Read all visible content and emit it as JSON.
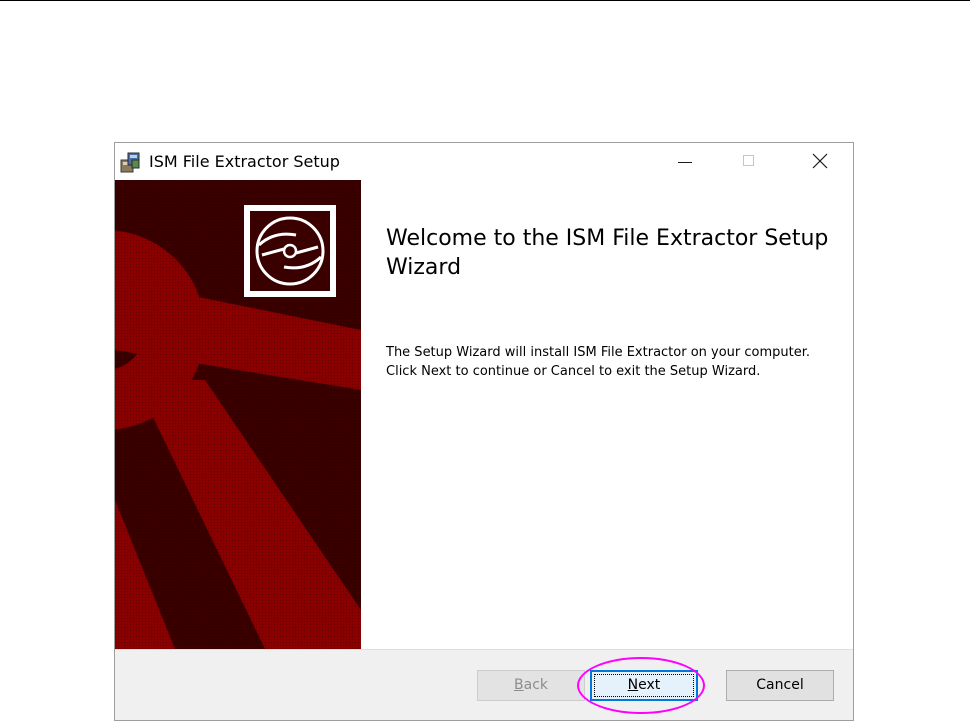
{
  "window": {
    "title": "ISM File Extractor Setup",
    "icon": "installer-package-icon",
    "controls": {
      "minimize_icon": "minimize-icon",
      "maximize_icon": "maximize-icon",
      "close_icon": "close-icon"
    }
  },
  "welcome": {
    "heading": "Welcome to the ISM File Extractor Setup Wizard",
    "body": "The Setup Wizard will install ISM File Extractor on your computer. Click Next to continue or Cancel to exit the Setup Wizard."
  },
  "banner": {
    "icon": "cd-disc-icon"
  },
  "buttons": {
    "back": {
      "prefix": "",
      "mnemonic": "B",
      "rest": "ack",
      "enabled": false
    },
    "next": {
      "prefix": "",
      "mnemonic": "N",
      "rest": "ext",
      "enabled": true,
      "focused": true
    },
    "cancel": {
      "label": "Cancel",
      "enabled": true
    }
  },
  "annotation": {
    "target": "next-button",
    "color": "#ff00ff"
  },
  "colors": {
    "banner_dark": "#3a0000",
    "banner_red": "#880000",
    "accent_blue": "#0078d7",
    "footer_bg": "#f0f0f0"
  }
}
